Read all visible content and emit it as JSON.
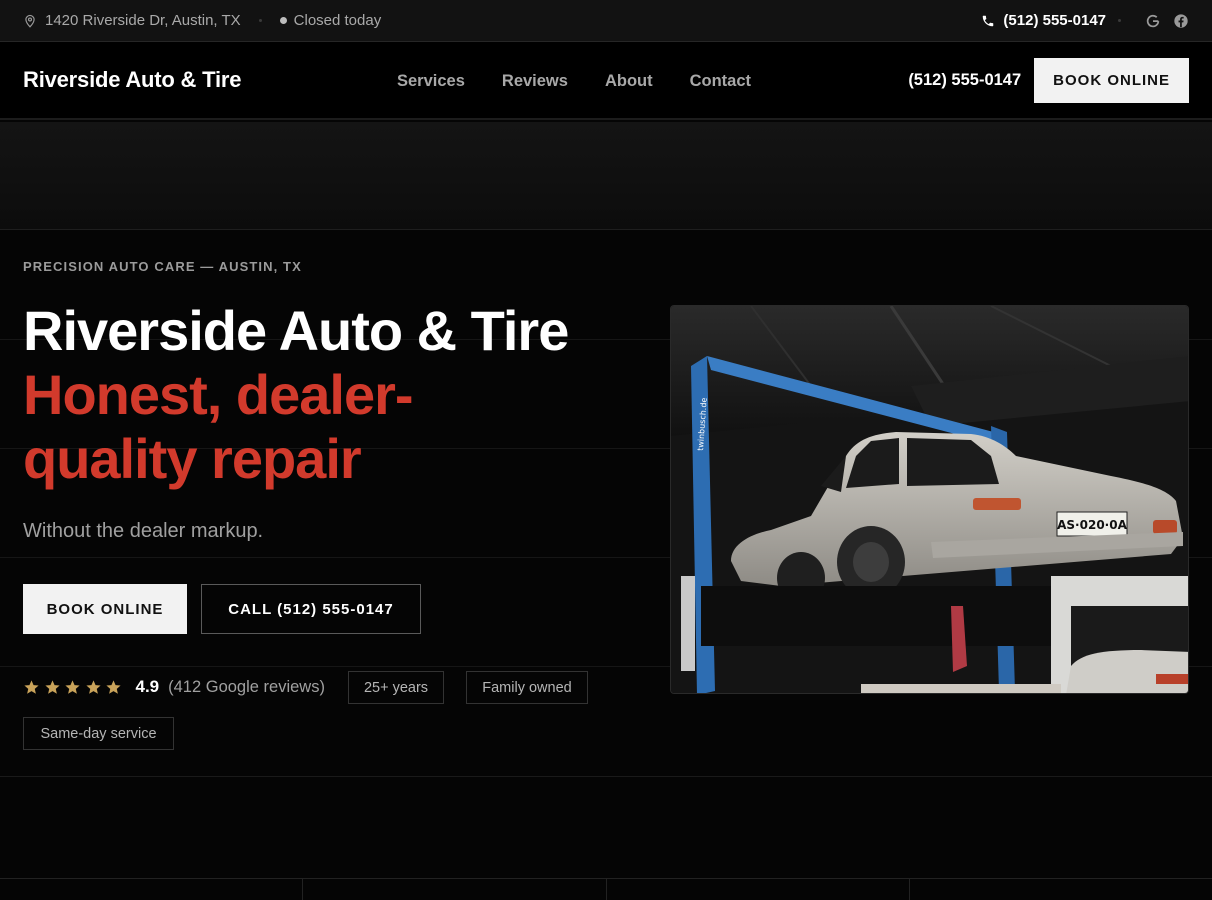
{
  "topbar": {
    "address": "1420 Riverside Dr, Austin, TX",
    "status": "Closed today",
    "phone": "(512) 555-0147",
    "social": [
      "google-icon",
      "facebook-icon"
    ]
  },
  "header": {
    "brand": "Riverside Auto & Tire",
    "nav": [
      "Services",
      "Reviews",
      "About",
      "Contact"
    ],
    "phone": "(512) 555-0147",
    "book_label": "BOOK ONLINE"
  },
  "hero": {
    "eyebrow": "PRECISION AUTO CARE — AUSTIN, TX",
    "title": "Riverside Auto & Tire",
    "title_red_line1": "Honest, dealer-",
    "title_red_line2": "quality repair",
    "subtitle": "Without the dealer markup.",
    "cta_primary": "BOOK ONLINE",
    "cta_secondary": "CALL (512) 555-0147",
    "rating": {
      "stars": 5,
      "score": "4.9",
      "reviews": "(412 Google reviews)"
    },
    "badges": [
      "25+ years",
      "Family owned",
      "Same-day service"
    ],
    "image": {
      "plate_text": "AS·020·0A",
      "lift_brand": "twinbusch.de"
    }
  },
  "colors": {
    "accent_red": "#d23a2c",
    "star_gold": "#c9a35a",
    "background": "#050505"
  }
}
